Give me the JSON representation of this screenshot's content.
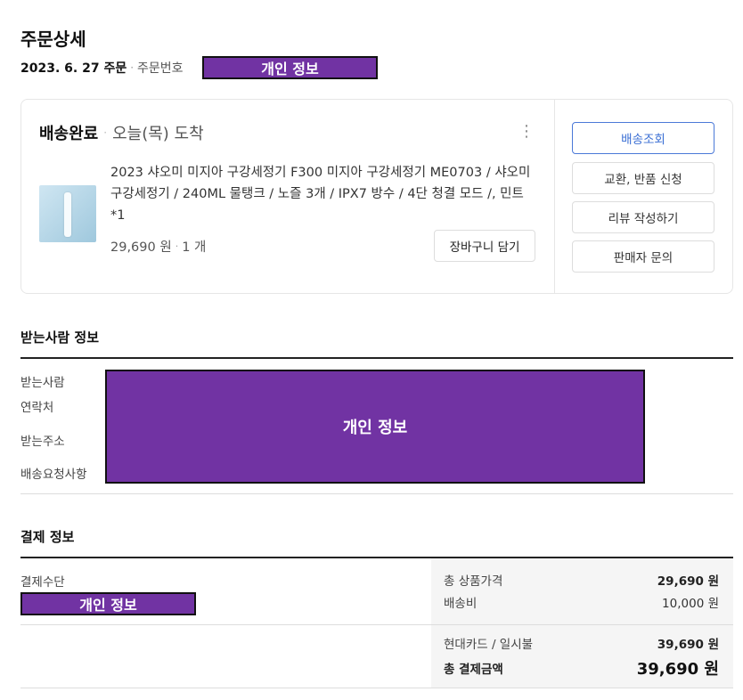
{
  "page": {
    "title": "주문상세"
  },
  "order": {
    "date": "2023. 6. 27 주문",
    "order_number_label": "주문번호",
    "redaction_text": "개인 정보"
  },
  "card": {
    "status": "배송완료",
    "arrival": "오늘(목) 도착",
    "product_name": "2023 샤오미 미지아 구강세정기 F300 미지아 구강세정기 ME0703 / 샤오미 구강세정기 / 240ML 물탱크 / 노즐 3개 / IPX7 방수 / 4단 청결 모드 /, 민트*1",
    "price": "29,690 원",
    "quantity": "1 개",
    "cart_button": "장바구니 담기",
    "side_buttons": [
      "배송조회",
      "교환, 반품 신청",
      "리뷰 작성하기",
      "판매자 문의"
    ]
  },
  "recipient": {
    "title": "받는사람 정보",
    "labels": [
      "받는사람",
      "연락처",
      "받는주소",
      "배송요청사항"
    ],
    "redaction_text": "개인 정보"
  },
  "payment": {
    "title": "결제 정보",
    "method_label": "결제수단",
    "redaction_text": "개인 정보",
    "rows": [
      {
        "label": "총 상품가격",
        "value": "29,690 원"
      },
      {
        "label": "배송비",
        "value": "10,000 원"
      }
    ],
    "card_row": {
      "label": "현대카드 / 일시불",
      "value": "39,690 원"
    },
    "total": {
      "label": "총 결제금액",
      "value": "39,690 원"
    }
  },
  "colors": {
    "accent": "#3b6fd4",
    "redaction": "#7133a3"
  }
}
